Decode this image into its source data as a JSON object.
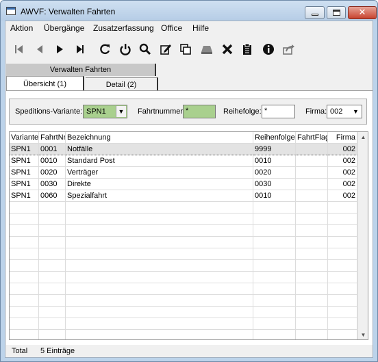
{
  "window": {
    "title": "AWVF: Verwalten Fahrten"
  },
  "menu": [
    "Aktion",
    "Übergänge",
    "Zusatzerfassung",
    "Office",
    "Hilfe"
  ],
  "toolbar": {
    "icons": [
      "first-icon",
      "previous-icon",
      "next-icon",
      "last-icon",
      "refresh-icon",
      "power-icon",
      "search-icon",
      "edit-icon",
      "copy-icon",
      "eraser-icon",
      "delete-icon",
      "clipboard-icon",
      "info-icon",
      "export-icon"
    ]
  },
  "tab_header": "Verwalten Fahrten",
  "tabs": [
    {
      "label": "Übersicht (1)",
      "active": true
    },
    {
      "label": "Detail (2)",
      "active": false
    }
  ],
  "filter": {
    "variante_label": "Speditions-Variante:",
    "variante_value": "SPN1",
    "fahrtnummer_label": "Fahrtnummer:",
    "fahrtnummer_value": "*",
    "reihefolge_label": "Reihefolge:",
    "reihefolge_value": "*",
    "firma_label": "Firma:",
    "firma_value": "002"
  },
  "grid": {
    "columns": [
      "Variante",
      "FahrtNr",
      "Bezeichnung",
      "Reihenfolge",
      "FahrtFlag",
      "Firma"
    ],
    "rows": [
      [
        "SPN1",
        "0001",
        "Notfälle",
        "9999",
        "",
        "002"
      ],
      [
        "SPN1",
        "0010",
        "Standard Post",
        "0010",
        "",
        "002"
      ],
      [
        "SPN1",
        "0020",
        "Verträger",
        "0020",
        "",
        "002"
      ],
      [
        "SPN1",
        "0030",
        "Direkte",
        "0030",
        "",
        "002"
      ],
      [
        "SPN1",
        "0060",
        "Spezialfahrt",
        "0010",
        "",
        "002"
      ]
    ],
    "selected_row": 0
  },
  "status": {
    "total_label": "Total",
    "count_text": "5 Einträge"
  },
  "colors": {
    "field_highlight": "#a9d08e",
    "title_bar": "#bcd3ea",
    "close_button": "#c7432f"
  }
}
